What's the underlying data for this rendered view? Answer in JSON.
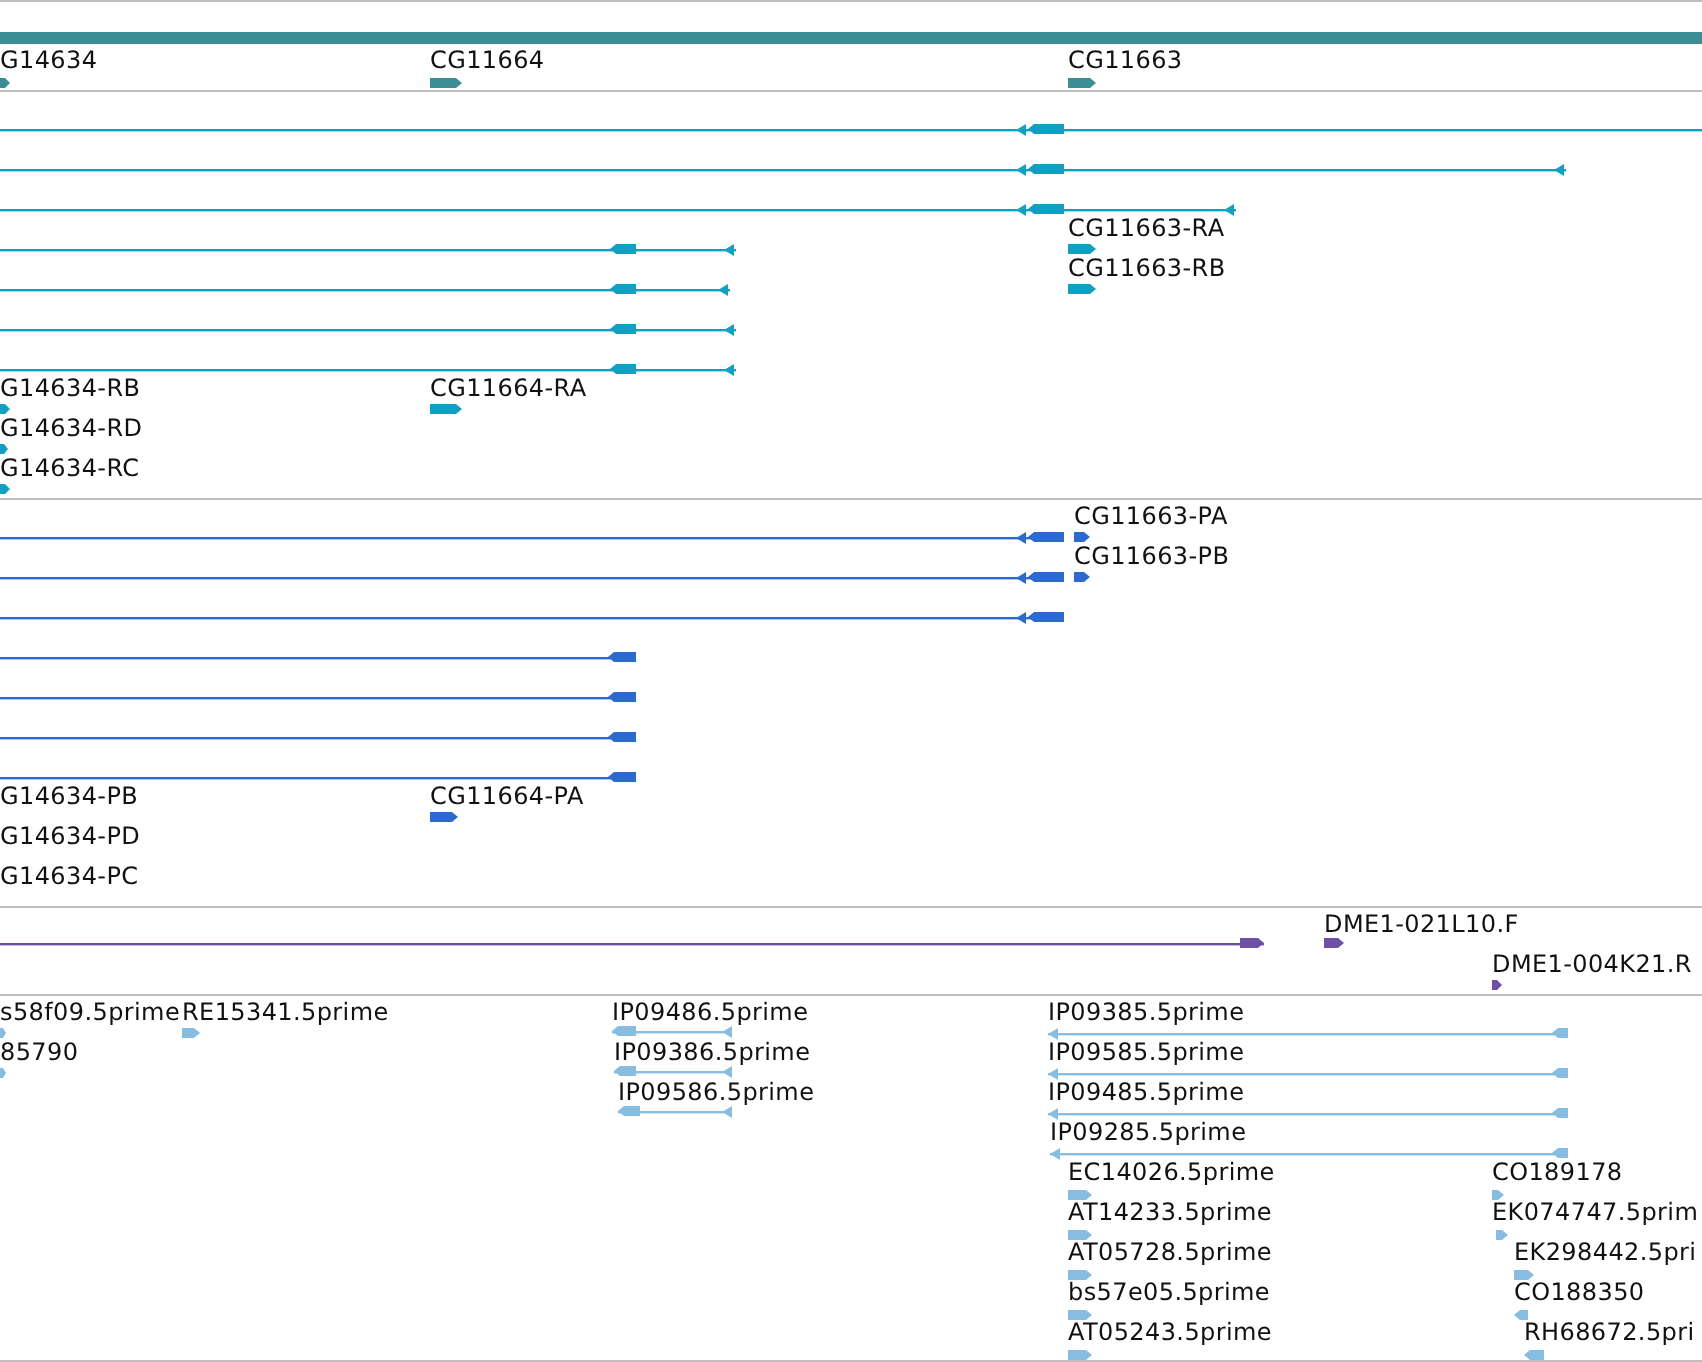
{
  "tracks": [
    {
      "color": "#3b8e93",
      "features": [
        {
          "kind": "marker",
          "label": "G14634",
          "reverse": false
        },
        {
          "kind": "marker",
          "label": "CG11664",
          "reverse": false
        },
        {
          "kind": "marker",
          "label": "CG11663",
          "reverse": false
        }
      ]
    },
    {
      "color": "#11a0c2",
      "features": [
        {
          "kind": "span",
          "reverse": true
        },
        {
          "kind": "span",
          "reverse": true
        },
        {
          "kind": "span",
          "reverse": true
        },
        {
          "kind": "marker",
          "label": "CG11663-RA",
          "reverse": false
        },
        {
          "kind": "span",
          "reverse": true
        },
        {
          "kind": "marker",
          "label": "CG11663-RB",
          "reverse": false
        },
        {
          "kind": "span",
          "reverse": true
        },
        {
          "kind": "span",
          "reverse": true
        },
        {
          "kind": "span",
          "reverse": true
        },
        {
          "kind": "marker",
          "label": "G14634-RB",
          "reverse": false
        },
        {
          "kind": "marker",
          "label": "CG11664-RA",
          "reverse": false
        },
        {
          "kind": "marker",
          "label": "G14634-RD",
          "reverse": false
        },
        {
          "kind": "marker",
          "label": "G14634-RC",
          "reverse": false
        }
      ]
    },
    {
      "color": "#2d6ad0",
      "features": [
        {
          "kind": "marker",
          "label": "CG11663-PA",
          "reverse": false
        },
        {
          "kind": "span",
          "reverse": true
        },
        {
          "kind": "marker",
          "label": "CG11663-PB",
          "reverse": false
        },
        {
          "kind": "span",
          "reverse": true
        },
        {
          "kind": "span",
          "reverse": true
        },
        {
          "kind": "span",
          "reverse": true
        },
        {
          "kind": "span",
          "reverse": true
        },
        {
          "kind": "span",
          "reverse": true
        },
        {
          "kind": "span",
          "reverse": true
        },
        {
          "kind": "label",
          "label": "G14634-PB"
        },
        {
          "kind": "marker",
          "label": "CG11664-PA",
          "reverse": false
        },
        {
          "kind": "label",
          "label": "G14634-PD"
        },
        {
          "kind": "label",
          "label": "G14634-PC"
        }
      ]
    },
    {
      "color": "#6e4fa6",
      "features": [
        {
          "kind": "span",
          "reverse": false
        },
        {
          "kind": "marker",
          "label": "DME1-021L10.F",
          "reverse": false
        },
        {
          "kind": "marker",
          "label": "DME1-004K21.R",
          "reverse": false
        }
      ]
    },
    {
      "color": "#86bde0",
      "features": [
        {
          "kind": "marker",
          "label": "s58f09.5prime",
          "reverse": false
        },
        {
          "kind": "marker",
          "label": "RE15341.5prime",
          "reverse": false
        },
        {
          "kind": "span",
          "label": "IP09486.5prime",
          "reverse": true
        },
        {
          "kind": "span",
          "label": "IP09385.5prime",
          "reverse": true
        },
        {
          "kind": "marker",
          "label": "85790",
          "reverse": false
        },
        {
          "kind": "span",
          "label": "IP09386.5prime",
          "reverse": true
        },
        {
          "kind": "span",
          "label": "IP09585.5prime",
          "reverse": true
        },
        {
          "kind": "span",
          "label": "IP09586.5prime",
          "reverse": true
        },
        {
          "kind": "span",
          "label": "IP09485.5prime",
          "reverse": true
        },
        {
          "kind": "span",
          "label": "IP09285.5prime",
          "reverse": true
        },
        {
          "kind": "marker",
          "label": "EC14026.5prime",
          "reverse": false
        },
        {
          "kind": "marker",
          "label": "CO189178",
          "reverse": false
        },
        {
          "kind": "marker",
          "label": "AT14233.5prime",
          "reverse": false
        },
        {
          "kind": "marker",
          "label": "EK074747.5prim",
          "reverse": false
        },
        {
          "kind": "marker",
          "label": "AT05728.5prime",
          "reverse": false
        },
        {
          "kind": "marker",
          "label": "EK298442.5pri",
          "reverse": false
        },
        {
          "kind": "marker",
          "label": "bs57e05.5prime",
          "reverse": false
        },
        {
          "kind": "marker",
          "label": "CO188350",
          "reverse": true
        },
        {
          "kind": "marker",
          "label": "AT05243.5prime",
          "reverse": false
        },
        {
          "kind": "marker",
          "label": "RH68672.5pri",
          "reverse": true
        }
      ]
    }
  ]
}
